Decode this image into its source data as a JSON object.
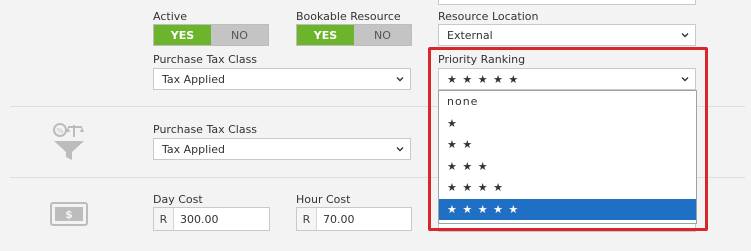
{
  "fields": {
    "active": {
      "label": "Active",
      "yes": "YES",
      "no": "NO"
    },
    "bookable": {
      "label": "Bookable Resource",
      "yes": "YES",
      "no": "NO"
    },
    "resource_location": {
      "label": "Resource Location",
      "value": "External"
    },
    "purchase_tax_top": {
      "label": "Purchase Tax Class",
      "value": "Tax Applied"
    },
    "priority_ranking": {
      "label": "Priority Ranking",
      "value": "★ ★ ★ ★ ★"
    },
    "purchase_tax_mid": {
      "label": "Purchase Tax Class",
      "value": "Tax Applied"
    },
    "day_cost": {
      "label": "Day Cost",
      "prefix": "R",
      "value": "300.00"
    },
    "hour_cost": {
      "label": "Hour Cost",
      "prefix": "R",
      "value": "70.00"
    }
  },
  "priority_options": [
    "none",
    "★",
    "★ ★",
    "★ ★ ★",
    "★ ★ ★ ★",
    "★ ★ ★ ★ ★"
  ],
  "priority_selected_index": 5,
  "colors": {
    "toggle_on": "#6cb42c",
    "toggle_off": "#c4c4c4",
    "dropdown_selected": "#1f6fc5",
    "highlight_border": "#d9262b"
  },
  "icons": {
    "tax": "tax-scale-icon",
    "cost": "money-bill-icon"
  }
}
